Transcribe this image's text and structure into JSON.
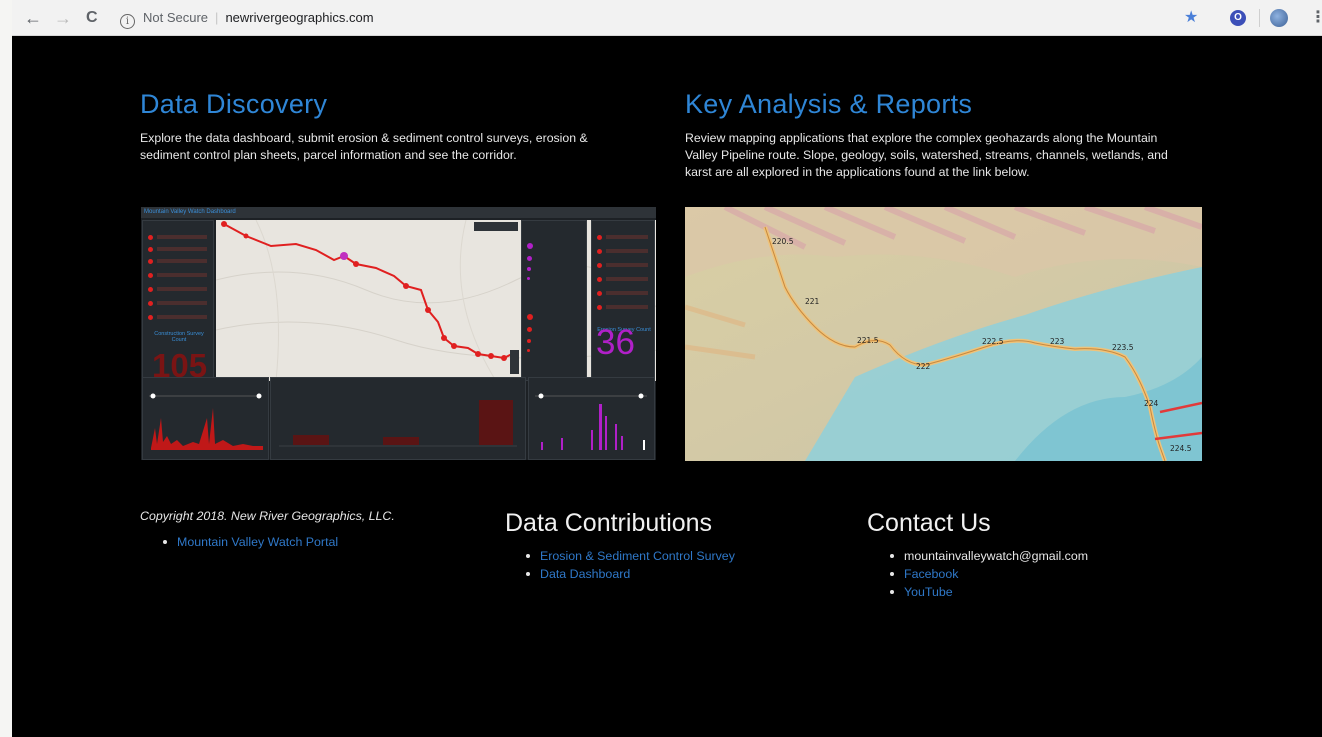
{
  "browser": {
    "back_glyph": "←",
    "forward_glyph": "→",
    "reload_glyph": "C",
    "info_glyph": "i",
    "security_label": "Not Secure",
    "separator": "|",
    "url": "newrivergeographics.com",
    "bookmark_glyph": "★",
    "extension_glyph": "O",
    "menu_glyph": "⋮"
  },
  "data_discovery": {
    "title": "Data Discovery",
    "description": "Explore the data dashboard, submit erosion & sediment control surveys, erosion & sediment control plan sheets, parcel information and see the corridor."
  },
  "dashboard_preview": {
    "header_title": "Mountain Valley Watch Dashboard",
    "left_label": "Construction Survey Count",
    "left_count": "105",
    "right_label": "Erosion Survey Count",
    "right_count": "36"
  },
  "key_analysis": {
    "title": "Key Analysis & Reports",
    "description": "Review mapping applications that explore the complex geohazards along the Mountain Valley Pipeline route. Slope, geology, soils, watershed, streams, channels, wetlands, and karst are all explored in the applications found at the link below."
  },
  "map_preview": {
    "milepost_labels": [
      "220.5",
      "221",
      "221.5",
      "222",
      "222.5",
      "223",
      "223.5",
      "224",
      "224.5"
    ]
  },
  "footer": {
    "copyright": "Copyright 2018. New River Geographics, LLC.",
    "portal_link": "Mountain Valley Watch Portal",
    "contributions": {
      "title": "Data Contributions",
      "links": [
        "Erosion & Sediment Control Survey",
        "Data Dashboard"
      ]
    },
    "contact": {
      "title": "Contact Us",
      "email": "mountainvalleywatch@gmail.com",
      "links": [
        "Facebook",
        "YouTube"
      ]
    }
  },
  "colors": {
    "heading_blue": "#2f86d6",
    "link_blue": "#2f78c8",
    "background": "#000000",
    "survey_red": "#e02020",
    "survey_purple": "#b020c8"
  }
}
